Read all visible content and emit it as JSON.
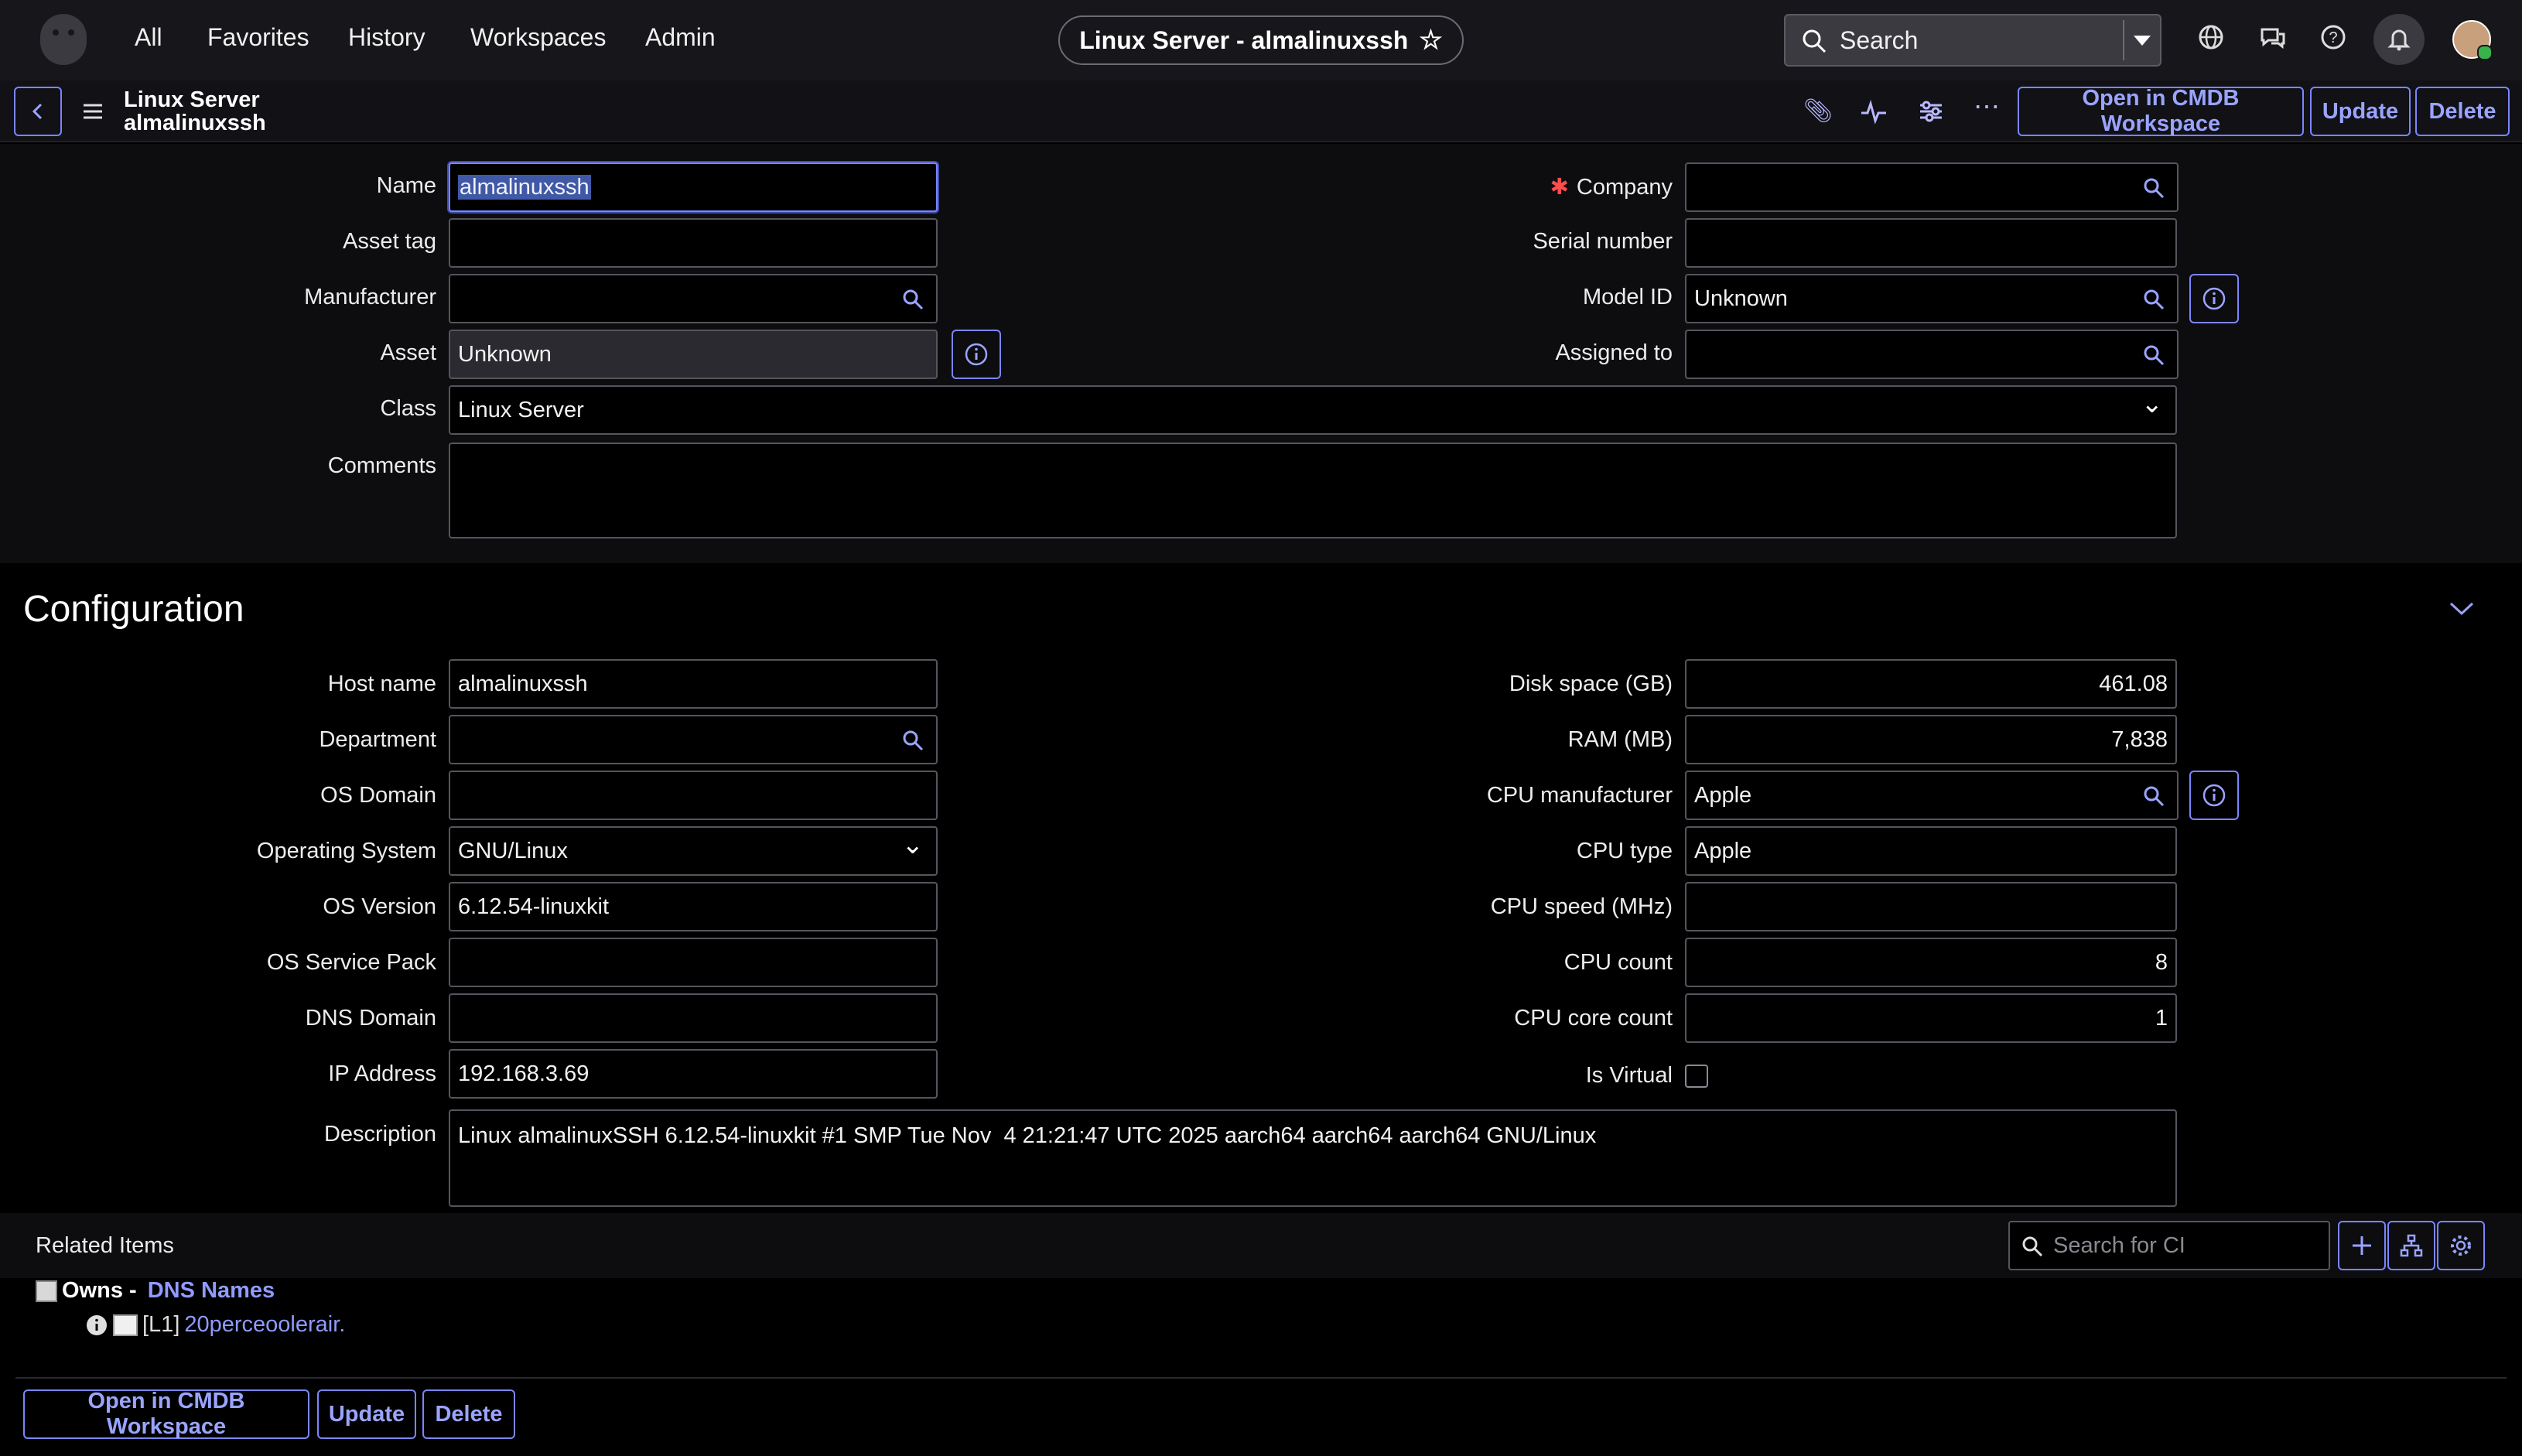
{
  "nav": {
    "items": [
      "All",
      "Favorites",
      "History",
      "Workspaces",
      "Admin"
    ],
    "record_title": "Linux Server - almalinuxssh",
    "search_placeholder": "Search"
  },
  "record_header": {
    "type": "Linux Server",
    "name": "almalinuxssh",
    "buttons": {
      "open_cmdb": "Open in CMDB Workspace",
      "update": "Update",
      "delete": "Delete"
    }
  },
  "form": {
    "name": {
      "label": "Name",
      "value": "almalinuxssh"
    },
    "asset_tag": {
      "label": "Asset tag",
      "value": ""
    },
    "manufacturer": {
      "label": "Manufacturer",
      "value": ""
    },
    "asset": {
      "label": "Asset",
      "value": "Unknown"
    },
    "class": {
      "label": "Class",
      "value": "Linux Server"
    },
    "comments": {
      "label": "Comments",
      "value": ""
    },
    "company": {
      "label": "Company",
      "value": "",
      "required_mark": "✱"
    },
    "serial_number": {
      "label": "Serial number",
      "value": ""
    },
    "model_id": {
      "label": "Model ID",
      "value": "Unknown"
    },
    "assigned_to": {
      "label": "Assigned to",
      "value": ""
    }
  },
  "configuration": {
    "title": "Configuration",
    "host_name": {
      "label": "Host name",
      "value": "almalinuxssh"
    },
    "department": {
      "label": "Department",
      "value": ""
    },
    "os_domain": {
      "label": "OS Domain",
      "value": ""
    },
    "operating_system": {
      "label": "Operating System",
      "value": "GNU/Linux"
    },
    "os_version": {
      "label": "OS Version",
      "value": "6.12.54-linuxkit"
    },
    "os_service_pack": {
      "label": "OS Service Pack",
      "value": ""
    },
    "dns_domain": {
      "label": "DNS Domain",
      "value": ""
    },
    "ip_address": {
      "label": "IP Address",
      "value": "192.168.3.69"
    },
    "description": {
      "label": "Description",
      "value": "Linux almalinuxSSH 6.12.54-linuxkit #1 SMP Tue Nov  4 21:21:47 UTC 2025 aarch64 aarch64 aarch64 GNU/Linux"
    },
    "disk_space": {
      "label": "Disk space (GB)",
      "value": "461.08"
    },
    "ram": {
      "label": "RAM (MB)",
      "value": "7,838"
    },
    "cpu_manufacturer": {
      "label": "CPU manufacturer",
      "value": "Apple"
    },
    "cpu_type": {
      "label": "CPU type",
      "value": "Apple"
    },
    "cpu_speed": {
      "label": "CPU speed (MHz)",
      "value": ""
    },
    "cpu_count": {
      "label": "CPU count",
      "value": "8"
    },
    "cpu_core_count": {
      "label": "CPU core count",
      "value": "1"
    },
    "is_virtual": {
      "label": "Is Virtual",
      "checked": false
    }
  },
  "related": {
    "title": "Related Items",
    "search_placeholder": "Search for CI",
    "relation_prefix": "Owns - ",
    "relation_link": "DNS Names",
    "child_level": "[L1]",
    "child_link": "20perceoolerair."
  },
  "footer": {
    "open_cmdb": "Open in CMDB Workspace",
    "update": "Update",
    "delete": "Delete"
  },
  "colors": {
    "accent": "#7b86ff",
    "background": "#000000",
    "nav_bg": "#17171b",
    "required": "#ff4d4d"
  }
}
